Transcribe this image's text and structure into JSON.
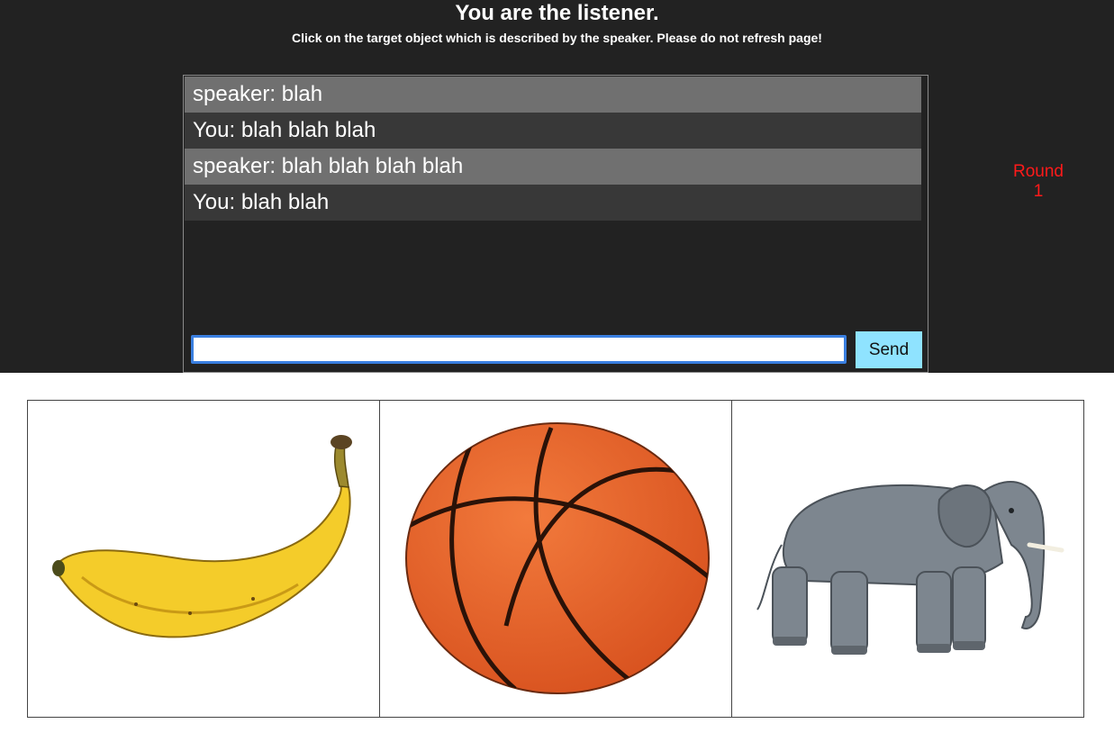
{
  "header": {
    "title": "You are the listener.",
    "subtitle": "Click on the target object which is described by the speaker. Please do not refresh page!"
  },
  "chat": {
    "messages": [
      {
        "role": "speaker",
        "text": "speaker: blah"
      },
      {
        "role": "you",
        "text": "You: blah blah blah"
      },
      {
        "role": "speaker",
        "text": "speaker: blah blah blah blah"
      },
      {
        "role": "you",
        "text": "You: blah blah"
      }
    ],
    "input_value": "",
    "send_label": "Send"
  },
  "round": {
    "label": "Round",
    "number": "1"
  },
  "objects": [
    {
      "name": "banana",
      "icon": "banana-image"
    },
    {
      "name": "basketball",
      "icon": "basketball-image"
    },
    {
      "name": "elephant",
      "icon": "elephant-image"
    }
  ],
  "colors": {
    "background_dark": "#222222",
    "speaker_row": "#707070",
    "you_row": "#383838",
    "send_button": "#8fe3ff",
    "round_text": "#ff1a1a",
    "input_focus": "#3a7fe0"
  }
}
